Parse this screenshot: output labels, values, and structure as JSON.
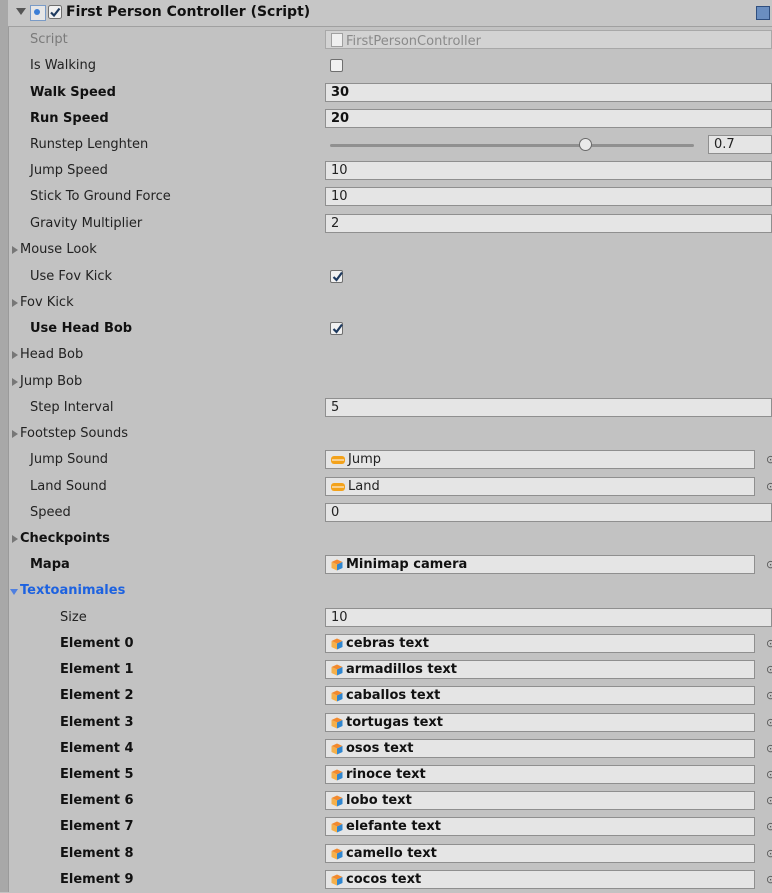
{
  "component": {
    "title": "First Person Controller (Script)",
    "enabled": true,
    "icons": {
      "fold": "fold-open-icon",
      "script": "script-icon",
      "help": "help-book-icon",
      "settings": "gear-icon"
    }
  },
  "script_row": {
    "label": "Script",
    "value": "FirstPersonController"
  },
  "is_walking": {
    "label": "Is Walking",
    "checked": false
  },
  "walk_speed": {
    "label": "Walk Speed",
    "value": "30"
  },
  "run_speed": {
    "label": "Run Speed",
    "value": "20"
  },
  "runstep": {
    "label": "Runstep Lenghten",
    "value": "0.7",
    "fraction": 0.7
  },
  "jump_speed": {
    "label": "Jump Speed",
    "value": "10"
  },
  "stick_force": {
    "label": "Stick To Ground Force",
    "value": "10"
  },
  "gravity": {
    "label": "Gravity Multiplier",
    "value": "2"
  },
  "mouse_look": {
    "label": "Mouse Look"
  },
  "use_fov_kick": {
    "label": "Use Fov Kick",
    "checked": true
  },
  "fov_kick": {
    "label": "Fov Kick"
  },
  "use_head_bob": {
    "label": "Use Head Bob",
    "checked": true
  },
  "head_bob": {
    "label": "Head Bob"
  },
  "jump_bob": {
    "label": "Jump Bob"
  },
  "step_interval": {
    "label": "Step Interval",
    "value": "5"
  },
  "footstep_sounds": {
    "label": "Footstep Sounds"
  },
  "jump_sound": {
    "label": "Jump Sound",
    "value": "Jump",
    "icon": "audio-clip-icon"
  },
  "land_sound": {
    "label": "Land Sound",
    "value": "Land",
    "icon": "audio-clip-icon"
  },
  "speed": {
    "label": "Speed",
    "value": "0"
  },
  "checkpoints": {
    "label": "Checkpoints"
  },
  "mapa": {
    "label": "Mapa",
    "value": "Minimap camera",
    "icon": "gameobject-icon"
  },
  "textoanimales": {
    "label": "Textoanimales",
    "size_label": "Size",
    "size_value": "10",
    "elements": [
      {
        "label": "Element 0",
        "value": "cebras text"
      },
      {
        "label": "Element 1",
        "value": "armadillos text"
      },
      {
        "label": "Element 2",
        "value": "caballos text"
      },
      {
        "label": "Element 3",
        "value": "tortugas text"
      },
      {
        "label": "Element 4",
        "value": "osos text"
      },
      {
        "label": "Element 5",
        "value": "rinoce text"
      },
      {
        "label": "Element 6",
        "value": "lobo text"
      },
      {
        "label": "Element 7",
        "value": "elefante text"
      },
      {
        "label": "Element 8",
        "value": "camello text"
      },
      {
        "label": "Element 9",
        "value": "cocos text"
      }
    ]
  },
  "colors": {
    "panel_bg": "#c2c2c2",
    "field_bg": "#e5e5e5",
    "highlight_label": "#1d62e0",
    "checkmark": "#1e3a5f",
    "audio_icon": "#f3a21b",
    "gameobject_icon_top": "#f28a2e",
    "gameobject_icon_side": "#2f86d0"
  }
}
